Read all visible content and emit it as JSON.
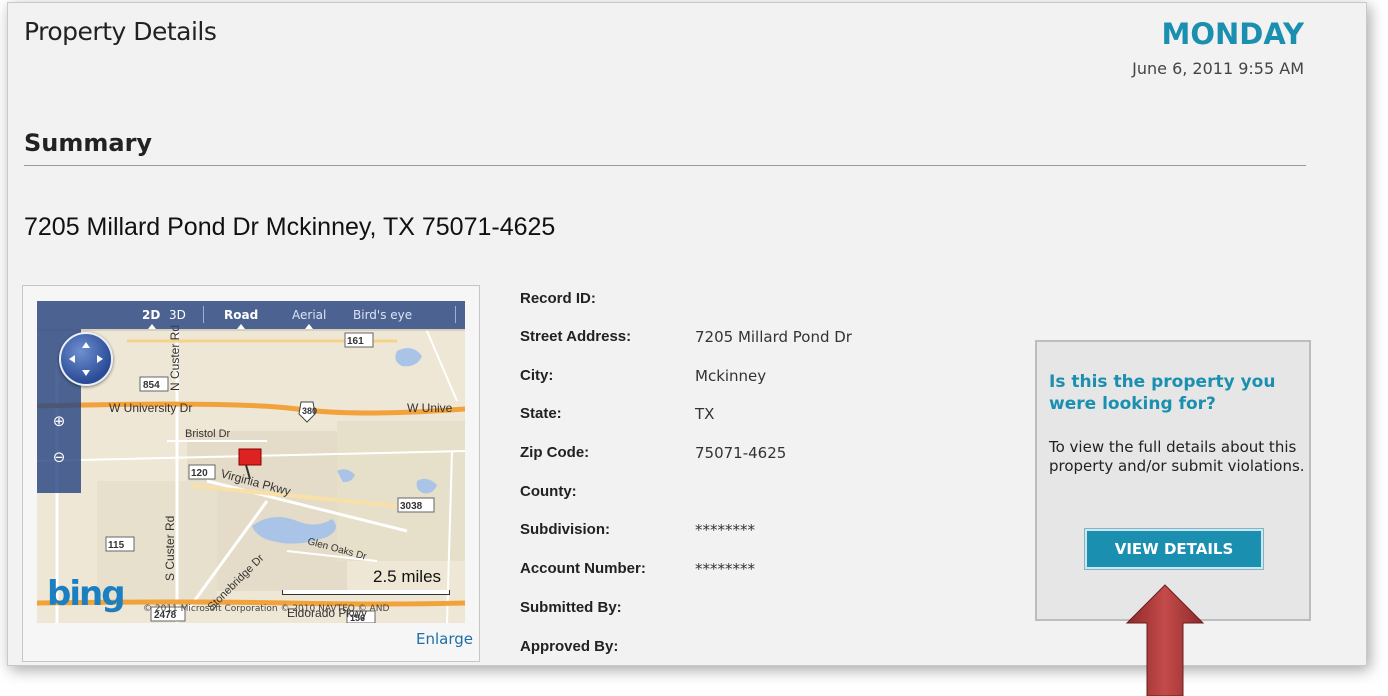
{
  "header": {
    "page_title": "Property Details",
    "day": "MONDAY",
    "datetime": "June 6, 2011 9:55 AM"
  },
  "summary": {
    "title": "Summary",
    "address": "7205 Millard Pond Dr Mckinney, TX 75071-4625"
  },
  "map": {
    "toolbar": {
      "mode_2d": "2D",
      "mode_3d": "3D",
      "road": "Road",
      "aerial": "Aerial",
      "birds_eye": "Bird's eye"
    },
    "zoom_in_icon": "zoom-in-icon",
    "zoom_out_icon": "zoom-out-icon",
    "logo": "bing",
    "scale_label": "2.5 miles",
    "copyright": "© 2011 Microsoft Corporation  © 2010 NAVTEQ  © AND",
    "labels": {
      "w_university_dr": "W University Dr",
      "w_unive": "W Unive",
      "bristol_dr": "Bristol Dr",
      "virginia_pkwy": "Virginia Pkwy",
      "glen_oaks_dr": "Glen Oaks Dr",
      "s_custer_rd": "S Custer Rd",
      "n_custer_rd": "N Custer Rd",
      "eldorado_pkwy": "Eldorado Pkwy",
      "stonebridge_dr": "Stonebridge Dr",
      "shield_161": "161",
      "shield_854": "854",
      "shield_380": "380",
      "shield_120": "120",
      "shield_3038": "3038",
      "shield_115": "115",
      "shield_2478": "2478",
      "shield_156": "156"
    },
    "enlarge_label": "Enlarge"
  },
  "details": {
    "fields": [
      {
        "label": "Record ID:",
        "value": ""
      },
      {
        "label": "Street Address:",
        "value": "7205 Millard Pond Dr"
      },
      {
        "label": "City:",
        "value": "Mckinney"
      },
      {
        "label": "State:",
        "value": "TX"
      },
      {
        "label": "Zip Code:",
        "value": "75071-4625"
      },
      {
        "label": "County:",
        "value": ""
      },
      {
        "label": "Subdivision:",
        "value": "********"
      },
      {
        "label": "Account Number:",
        "value": "********"
      },
      {
        "label": "Submitted By:",
        "value": ""
      },
      {
        "label": "Approved By:",
        "value": ""
      }
    ]
  },
  "cta": {
    "question": "Is this the property you were looking for?",
    "text": "To view the full details about this property and/or submit violations.",
    "button_label": "VIEW DETAILS"
  },
  "colors": {
    "accent": "#1a8fb0",
    "arrow": "#b23a3a",
    "map_toolbar": "#284682"
  }
}
